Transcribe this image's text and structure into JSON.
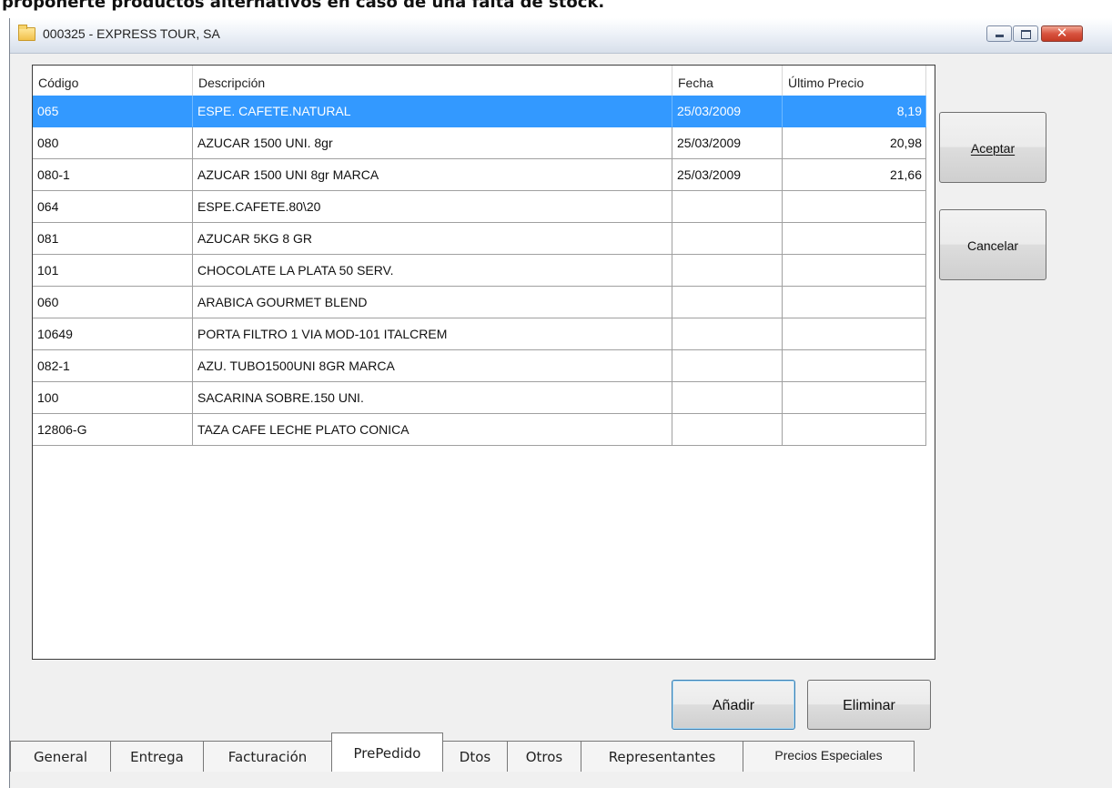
{
  "page_caption": "proponerte productos alternativos en caso de una falta de stock.",
  "window": {
    "title": "000325 - EXPRESS TOUR, SA",
    "controls": [
      "minimize",
      "maximize",
      "close"
    ],
    "close_glyph": "✕"
  },
  "grid": {
    "columns": [
      "Código",
      "Descripción",
      "Fecha",
      "Último Precio"
    ],
    "rows": [
      {
        "codigo": "065",
        "descripcion": "ESPE. CAFETE.NATURAL",
        "fecha": "25/03/2009",
        "precio": "8,19",
        "selected": true
      },
      {
        "codigo": "080",
        "descripcion": "AZUCAR 1500 UNI.  8gr",
        "fecha": "25/03/2009",
        "precio": "20,98"
      },
      {
        "codigo": "080-1",
        "descripcion": "AZUCAR 1500 UNI 8gr MARCA",
        "fecha": "25/03/2009",
        "precio": "21,66"
      },
      {
        "codigo": "064",
        "descripcion": "ESPE.CAFETE.80\\20",
        "fecha": "",
        "precio": ""
      },
      {
        "codigo": "081",
        "descripcion": "AZUCAR 5KG 8 GR",
        "fecha": "",
        "precio": ""
      },
      {
        "codigo": "101",
        "descripcion": "CHOCOLATE LA PLATA 50 SERV.",
        "fecha": "",
        "precio": ""
      },
      {
        "codigo": "060",
        "descripcion": "ARABICA GOURMET BLEND",
        "fecha": "",
        "precio": ""
      },
      {
        "codigo": "10649",
        "descripcion": "PORTA FILTRO 1 VIA MOD-101 ITALCREM",
        "fecha": "",
        "precio": ""
      },
      {
        "codigo": "082-1",
        "descripcion": "AZU. TUBO1500UNI 8GR   MARCA",
        "fecha": "",
        "precio": ""
      },
      {
        "codigo": "100",
        "descripcion": "SACARINA SOBRE.150 UNI.",
        "fecha": "",
        "precio": ""
      },
      {
        "codigo": "12806-G",
        "descripcion": "TAZA CAFE LECHE PLATO CONICA",
        "fecha": "",
        "precio": ""
      }
    ]
  },
  "buttons": {
    "aceptar": "Aceptar",
    "cancelar": "Cancelar",
    "anadir": "Añadir",
    "eliminar": "Eliminar"
  },
  "tabs": [
    "General",
    "Entrega",
    "Facturación",
    "PrePedido",
    "Dtos",
    "Otros",
    "Representantes",
    "Precios Especiales"
  ],
  "active_tab": "PrePedido",
  "colors": {
    "selection": "#3399ff",
    "titlebar": "#e4eaf2",
    "close_button": "#d8533f"
  }
}
